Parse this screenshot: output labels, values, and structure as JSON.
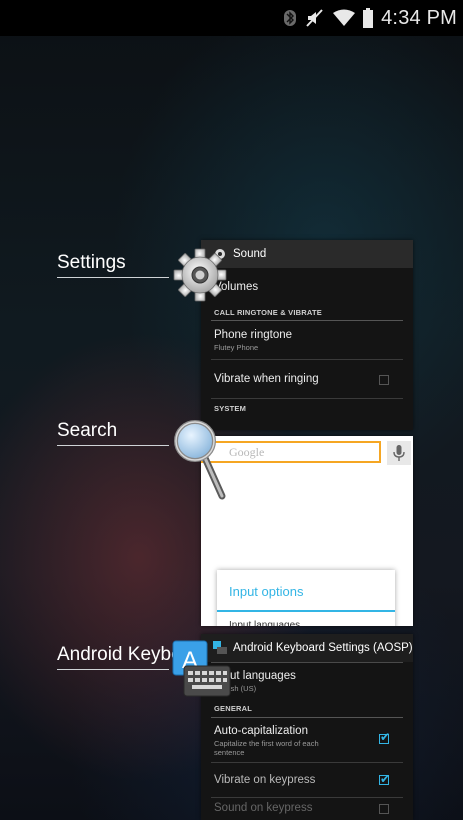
{
  "status_bar": {
    "time": "4:34 PM",
    "icons": [
      "bluetooth-icon",
      "mute-icon",
      "wifi-icon",
      "battery-icon"
    ]
  },
  "recent_apps": [
    {
      "label": "Settings",
      "icon": "settings-gear-icon",
      "thumbnail": {
        "header": "Sound",
        "items": [
          {
            "type": "row",
            "title": "Volumes"
          },
          {
            "type": "section",
            "title": "CALL RINGTONE & VIBRATE"
          },
          {
            "type": "row",
            "title": "Phone ringtone",
            "subtitle": "Flutey Phone"
          },
          {
            "type": "checkbox",
            "title": "Vibrate when ringing",
            "checked": false
          },
          {
            "type": "section",
            "title": "SYSTEM"
          }
        ]
      }
    },
    {
      "label": "Search",
      "icon": "search-magnifier-icon",
      "thumbnail": {
        "search_placeholder": "Google",
        "dialog_title": "Input options",
        "dialog_item": "Input languages"
      }
    },
    {
      "label": "Android Keyboard Settings (AOSP)",
      "icon": "keyboard-app-icon",
      "thumbnail": {
        "header": "Android Keyboard Settings (AOSP)",
        "items": [
          {
            "type": "row",
            "title": "Input languages",
            "subtitle": "English (US)"
          },
          {
            "type": "section",
            "title": "GENERAL"
          },
          {
            "type": "checkbox",
            "title": "Auto-capitalization",
            "subtitle": "Capitalize the first word of each sentence",
            "checked": true
          },
          {
            "type": "checkbox",
            "title": "Vibrate on keypress",
            "checked": true
          },
          {
            "type": "checkbox",
            "title": "Sound on keypress",
            "checked": false
          }
        ]
      }
    }
  ],
  "colors": {
    "accent": "#33b5e5",
    "search_focus": "#f5a623"
  }
}
